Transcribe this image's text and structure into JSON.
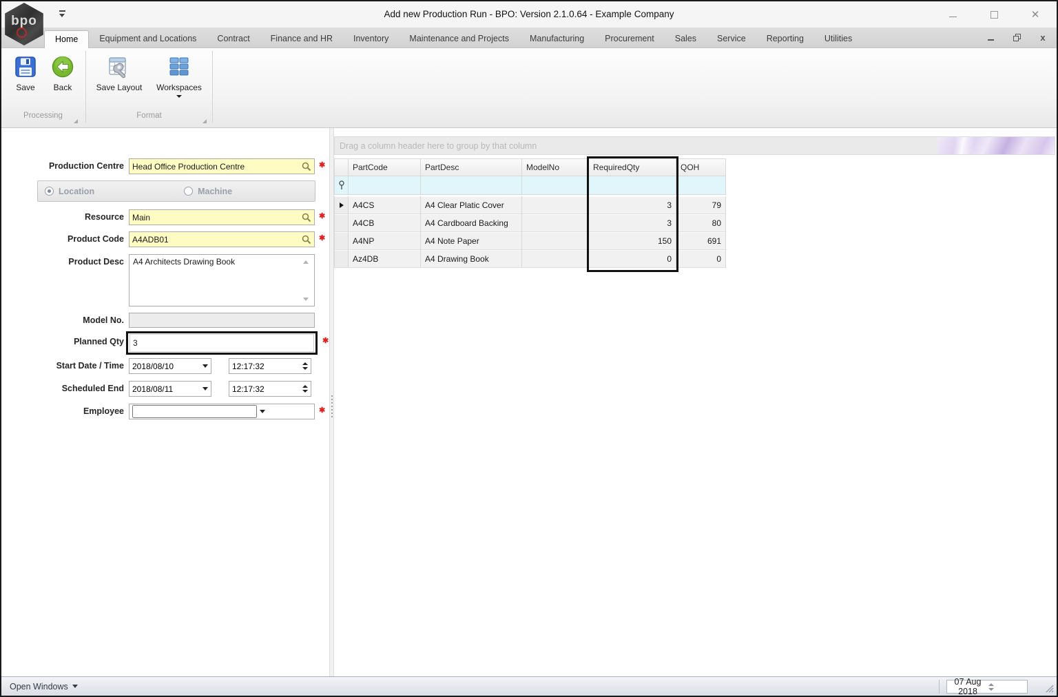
{
  "window": {
    "title": "Add new Production Run - BPO: Version 2.1.0.64 - Example Company",
    "logo_text": "bpo"
  },
  "tabs": {
    "items": [
      {
        "label": "Home"
      },
      {
        "label": "Equipment and Locations"
      },
      {
        "label": "Contract"
      },
      {
        "label": "Finance and HR"
      },
      {
        "label": "Inventory"
      },
      {
        "label": "Maintenance and Projects"
      },
      {
        "label": "Manufacturing"
      },
      {
        "label": "Procurement"
      },
      {
        "label": "Sales"
      },
      {
        "label": "Service"
      },
      {
        "label": "Reporting"
      },
      {
        "label": "Utilities"
      }
    ]
  },
  "ribbon": {
    "save_label": "Save",
    "back_label": "Back",
    "save_layout_label": "Save Layout",
    "workspaces_label": "Workspaces",
    "group_processing": "Processing",
    "group_format": "Format"
  },
  "form": {
    "production_centre": {
      "label": "Production Centre",
      "value": "Head Office Production Centre"
    },
    "radio": {
      "location_label": "Location",
      "machine_label": "Machine"
    },
    "resource": {
      "label": "Resource",
      "value": "Main"
    },
    "product_code": {
      "label": "Product Code",
      "value": "A4ADB01"
    },
    "product_desc": {
      "label": "Product Desc",
      "value": "A4 Architects Drawing Book"
    },
    "model_no": {
      "label": "Model No.",
      "value": ""
    },
    "planned_qty": {
      "label": "Planned Qty",
      "value": "3"
    },
    "start": {
      "label": "Start Date / Time",
      "date": "2018/08/10",
      "time": "12:17:32"
    },
    "end": {
      "label": "Scheduled End",
      "date": "2018/08/11",
      "time": "12:17:32"
    },
    "employee": {
      "label": "Employee",
      "value": ""
    }
  },
  "grid": {
    "group_hint": "Drag a column header here to group by that column",
    "columns": [
      "PartCode",
      "PartDesc",
      "ModelNo",
      "RequiredQty",
      "QOH"
    ],
    "rows": [
      {
        "PartCode": "A4CS",
        "PartDesc": "A4 Clear Platic Cover",
        "ModelNo": "",
        "RequiredQty": "3",
        "QOH": "79"
      },
      {
        "PartCode": "A4CB",
        "PartDesc": "A4 Cardboard Backing",
        "ModelNo": "",
        "RequiredQty": "3",
        "QOH": "80"
      },
      {
        "PartCode": "A4NP",
        "PartDesc": "A4 Note Paper",
        "ModelNo": "",
        "RequiredQty": "150",
        "QOH": "691"
      },
      {
        "PartCode": "Az4DB",
        "PartDesc": "A4 Drawing Book",
        "ModelNo": "",
        "RequiredQty": "0",
        "QOH": "0"
      }
    ]
  },
  "statusbar": {
    "open_windows_label": "Open Windows",
    "date": "07 Aug 2018"
  },
  "colors": {
    "field_lookup_bg": "#fefcc3",
    "required_asterisk": "#dd2222",
    "filter_row_bg": "#e0f6fb",
    "highlight_box": "#111111",
    "back_button_green": "#6aa81f",
    "save_button_blue": "#3b6fd4"
  }
}
